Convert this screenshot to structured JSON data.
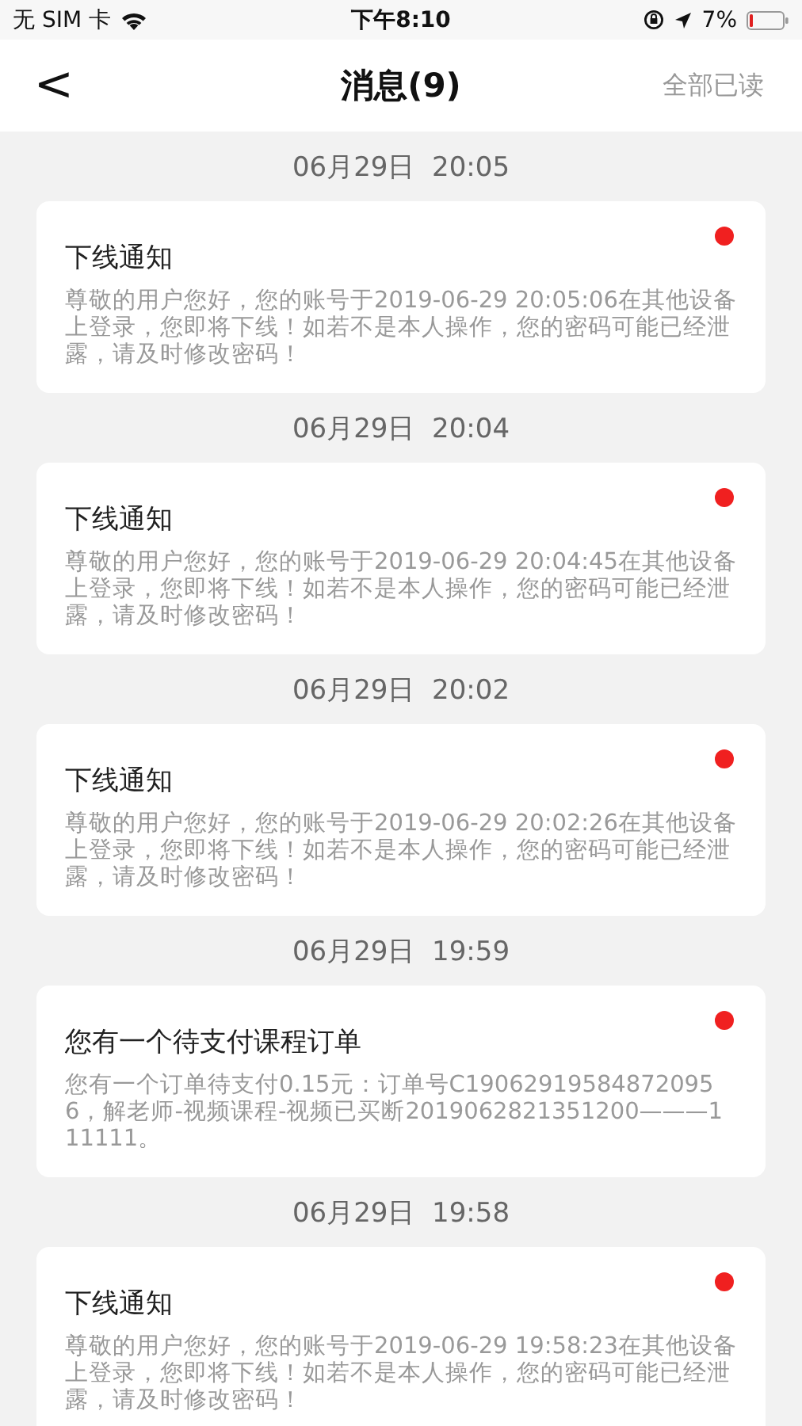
{
  "status_bar": {
    "carrier": "无 SIM 卡",
    "time": "下午8:10",
    "battery": "7%"
  },
  "nav": {
    "back": "<",
    "title": "消息(9)",
    "action": "全部已读"
  },
  "messages": [
    {
      "date": "06月29日  20:05",
      "title": "下线通知",
      "body": "尊敬的用户您好，您的账号于2019-06-29 20:05:06在其他设备上登录，您即将下线！如若不是本人操作，您的密码可能已经泄露，请及时修改密码！",
      "unread": true
    },
    {
      "date": "06月29日  20:04",
      "title": "下线通知",
      "body": "尊敬的用户您好，您的账号于2019-06-29 20:04:45在其他设备上登录，您即将下线！如若不是本人操作，您的密码可能已经泄露，请及时修改密码！",
      "unread": true
    },
    {
      "date": "06月29日  20:02",
      "title": "下线通知",
      "body": "尊敬的用户您好，您的账号于2019-06-29 20:02:26在其他设备上登录，您即将下线！如若不是本人操作，您的密码可能已经泄露，请及时修改密码！",
      "unread": true
    },
    {
      "date": "06月29日  19:59",
      "title": "您有一个待支付课程订单",
      "body": "您有一个订单待支付0.15元：订单号C190629195848720956，解老师-视频课程-视频已买断2019062821351200———111111。",
      "unread": true
    },
    {
      "date": "06月29日  19:58",
      "title": "下线通知",
      "body": "尊敬的用户您好，您的账号于2019-06-29 19:58:23在其他设备上登录，您即将下线！如若不是本人操作，您的密码可能已经泄露，请及时修改密码！",
      "unread": true
    }
  ]
}
